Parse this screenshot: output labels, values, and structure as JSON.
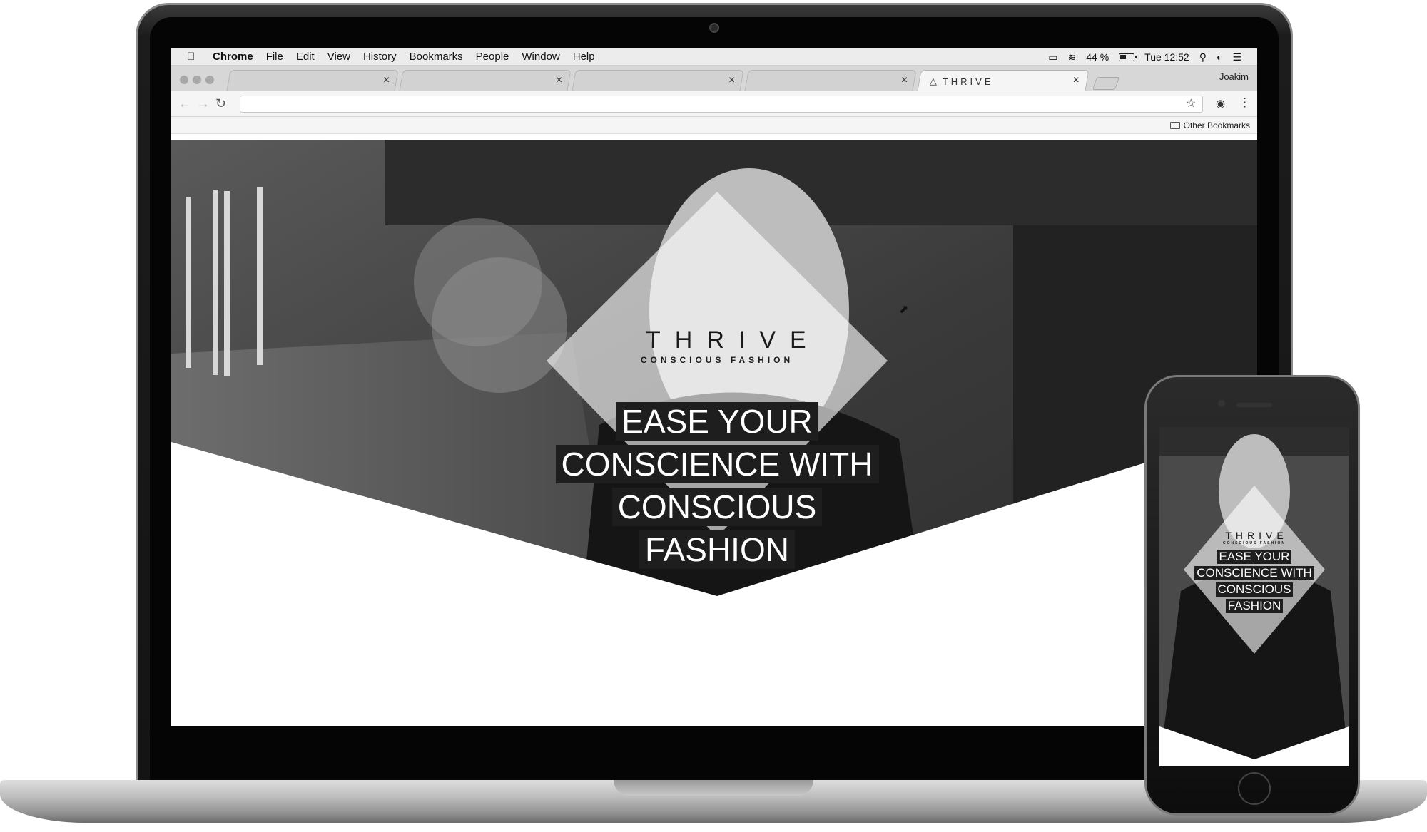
{
  "menubar": {
    "app": "Chrome",
    "items": [
      "File",
      "Edit",
      "View",
      "History",
      "Bookmarks",
      "People",
      "Window",
      "Help"
    ],
    "battery": "44 %",
    "clock": "Tue 12:52"
  },
  "browser": {
    "tabs": [
      {
        "title": ""
      },
      {
        "title": ""
      },
      {
        "title": ""
      },
      {
        "title": ""
      },
      {
        "title": "THRIVE"
      }
    ],
    "profile": "Joakim",
    "address": "",
    "bookmarks_other": "Other Bookmarks"
  },
  "hero": {
    "logo": "THRIVE",
    "logo_sub": "CONSCIOUS FASHION",
    "headline_lines": [
      "EASE YOUR",
      "CONSCIENCE WITH",
      "CONSCIOUS",
      "FASHION"
    ]
  },
  "phone": {
    "logo": "THRIVE",
    "logo_sub": "CONSCIOUS FASHION",
    "headline_lines": [
      "EASE YOUR",
      "CONSCIENCE WITH",
      "CONSCIOUS",
      "FASHION"
    ]
  }
}
